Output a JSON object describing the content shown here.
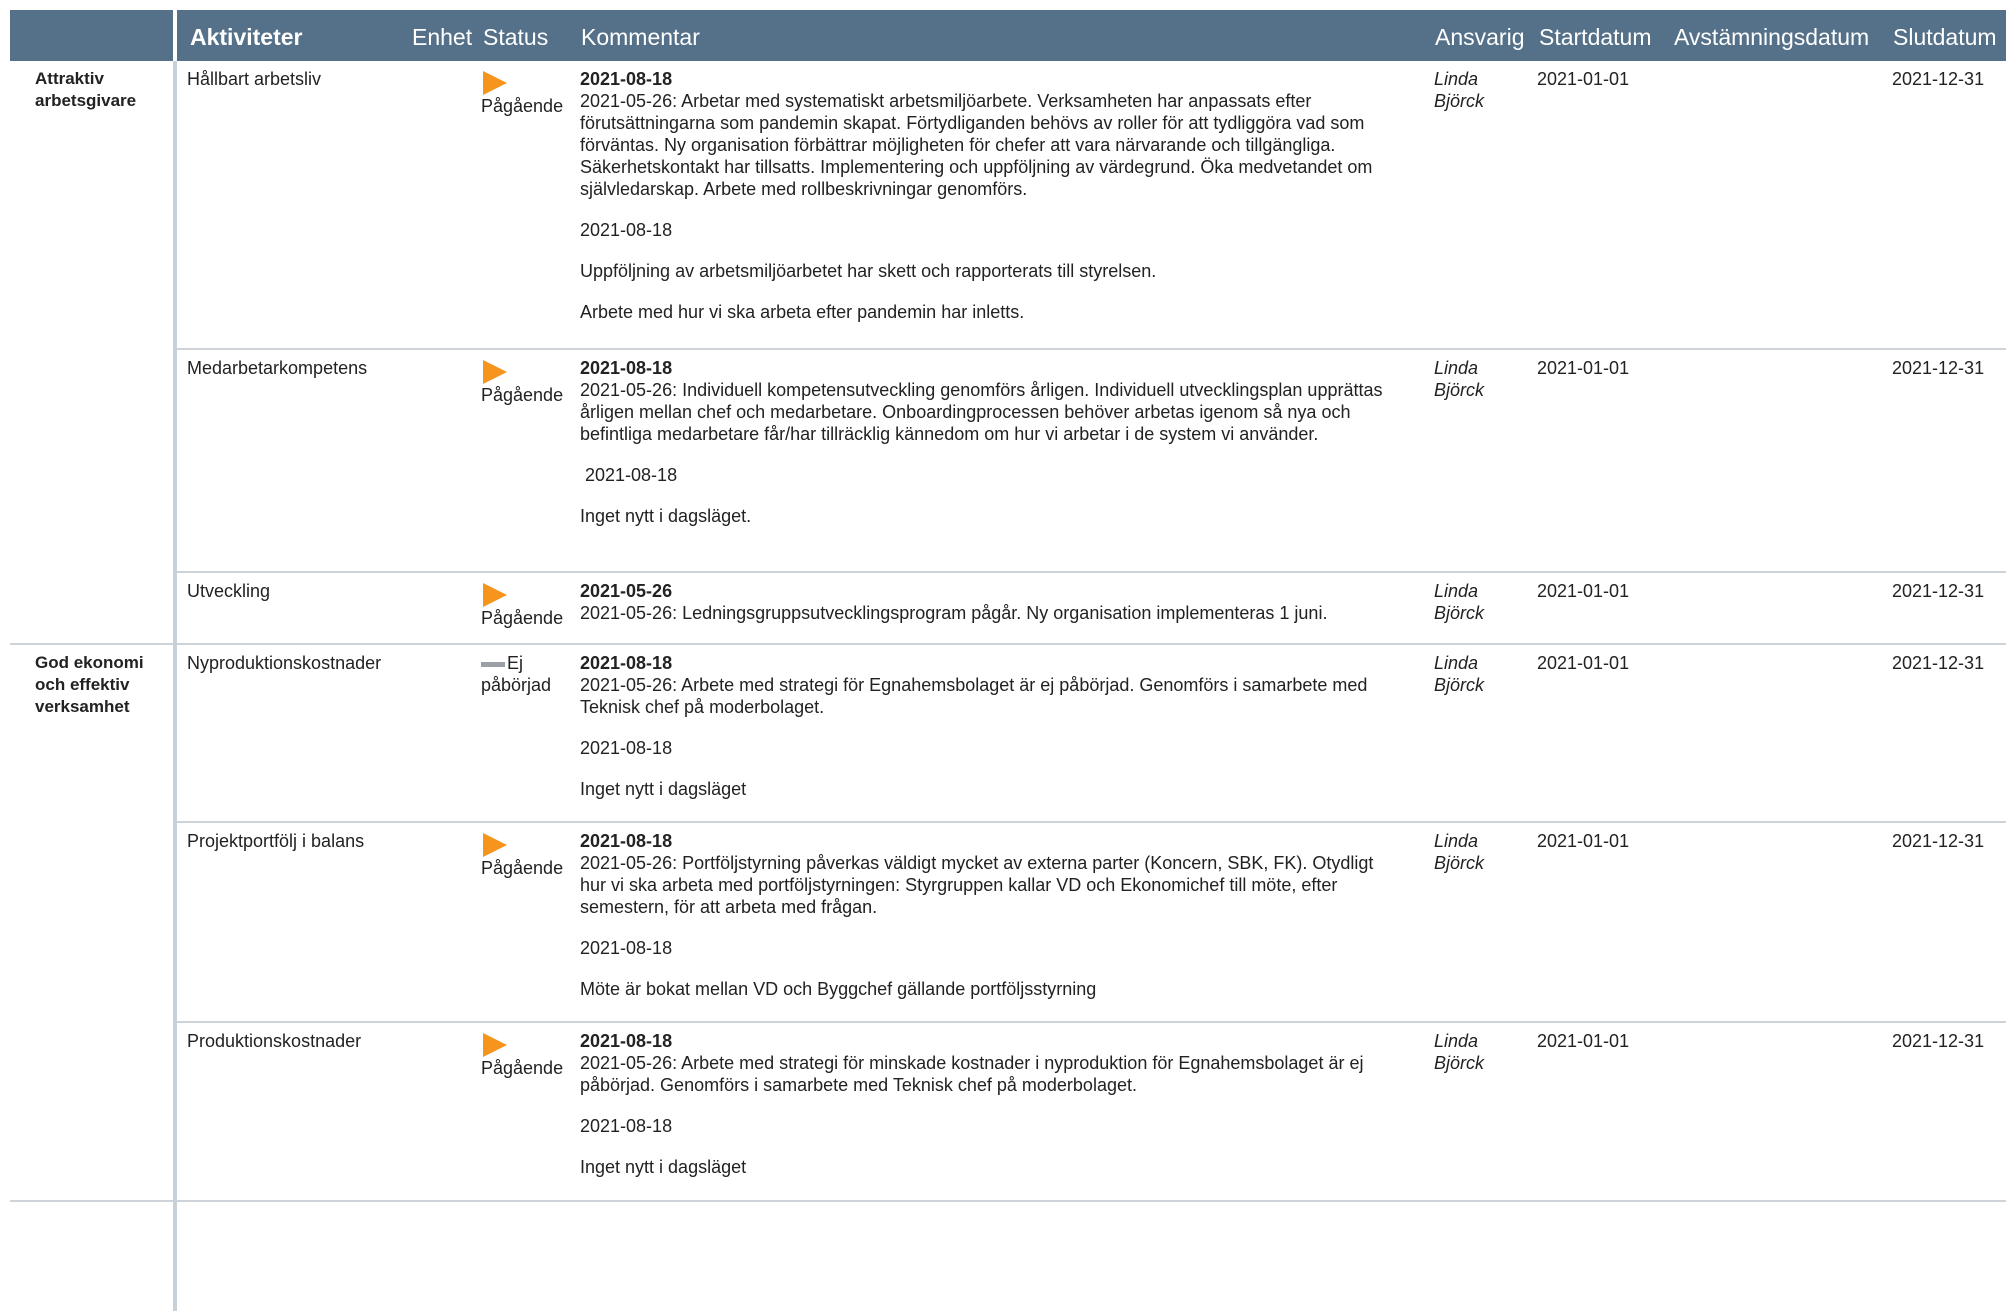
{
  "header": {
    "aktiviteter": "Aktiviteter",
    "enhet": "Enhet",
    "status": "Status",
    "kommentar": "Kommentar",
    "ansvarig": "Ansvarig",
    "startdatum": "Startdatum",
    "avstamningsdatum": "Avstämningsdatum",
    "slutdatum": "Slutdatum"
  },
  "groups": [
    {
      "label": "Attraktiv arbetsgivare"
    },
    {
      "label": "God ekonomi och effektiv verksamhet"
    }
  ],
  "rows": [
    {
      "activity": "Hållbart arbetsliv",
      "status_icon": "arrow-icon",
      "status_color": "#f7941d",
      "status": "Pågående",
      "comment_date": "2021-08-18",
      "comment_main": "2021-05-26: Arbetar med systematiskt arbetsmiljöarbete. Verksamheten har anpassats efter förutsättningarna som pandemin skapat. Förtydliganden behövs av roller för att tydliggöra vad som förväntas. Ny organisation förbättrar möjligheten för chefer att vara närvarande och tillgängliga. Säkerhetskontakt har tillsatts. Implementering och uppföljning av värdegrund. Öka medvetandet om självledarskap. Arbete med rollbeskrivningar genomförs.",
      "comment_p1": "2021-08-18",
      "comment_p2": "Uppföljning av arbetsmiljöarbetet har skett och rapporterats till styrelsen.",
      "comment_p3": "Arbete med hur vi ska arbeta efter pandemin har inletts.",
      "ansvarig": "Linda Björck",
      "start": "2021-01-01",
      "slut": "2021-12-31"
    },
    {
      "activity": "Medarbetarkompetens",
      "status_icon": "arrow-icon",
      "status": "Pågående",
      "comment_date": "2021-08-18",
      "comment_main": "2021-05-26: Individuell kompetensutveckling genomförs årligen. Individuell utvecklingsplan upprättas årligen mellan chef och medarbetare. Onboardingprocessen behöver arbetas igenom så nya och befintliga medarbetare får/har tillräcklig kännedom om hur vi arbetar i de system vi använder.",
      "comment_p1": " 2021-08-18",
      "comment_p2": "Inget nytt i dagsläget.",
      "ansvarig": "Linda Björck",
      "start": "2021-01-01",
      "slut": "2021-12-31"
    },
    {
      "activity": "Utveckling",
      "status_icon": "arrow-icon",
      "status": "Pågående",
      "comment_date": "2021-05-26",
      "comment_main": "2021-05-26: Ledningsgruppsutvecklingsprogram pågår. Ny organisation implementeras 1 juni.",
      "ansvarig": "Linda Björck",
      "start": "2021-01-01",
      "slut": "2021-12-31"
    },
    {
      "activity": "Nyproduktionskostnader",
      "status_icon": "dash-icon",
      "status_color": "#9aa0a5",
      "status": "Ej påbörjad",
      "comment_date": "2021-08-18",
      "comment_main": "2021-05-26: Arbete med strategi för Egnahemsbolaget är ej påbörjad. Genomförs i samarbete med Teknisk chef på moderbolaget.",
      "comment_p1": "2021-08-18",
      "comment_p2": "Inget nytt i dagsläget",
      "ansvarig": "Linda Björck",
      "start": "2021-01-01",
      "slut": "2021-12-31"
    },
    {
      "activity": "Projektportfölj i balans",
      "status_icon": "arrow-icon",
      "status": "Pågående",
      "comment_date": "2021-08-18",
      "comment_main": "2021-05-26: Portföljstyrning påverkas väldigt mycket av externa parter (Koncern, SBK, FK). Otydligt hur vi ska arbeta med portföljstyrningen: Styrgruppen kallar VD och Ekonomichef till möte, efter semestern, för att arbeta med frågan.",
      "comment_p1": "2021-08-18",
      "comment_p2": "Möte är bokat mellan VD och Byggchef gällande portföljsstyrning",
      "ansvarig": "Linda Björck",
      "start": "2021-01-01",
      "slut": "2021-12-31"
    },
    {
      "activity": "Produktionskostnader",
      "status_icon": "arrow-icon",
      "status": "Pågående",
      "comment_date": "2021-08-18",
      "comment_main": "2021-05-26: Arbete med strategi för minskade kostnader i nyproduktion för Egnahemsbolaget är ej påbörjad. Genomförs i samarbete med Teknisk chef på moderbolaget.",
      "comment_p1": "2021-08-18",
      "comment_p2": "Inget nytt i dagsläget",
      "ansvarig": "Linda Björck",
      "start": "2021-01-01",
      "slut": "2021-12-31"
    }
  ]
}
